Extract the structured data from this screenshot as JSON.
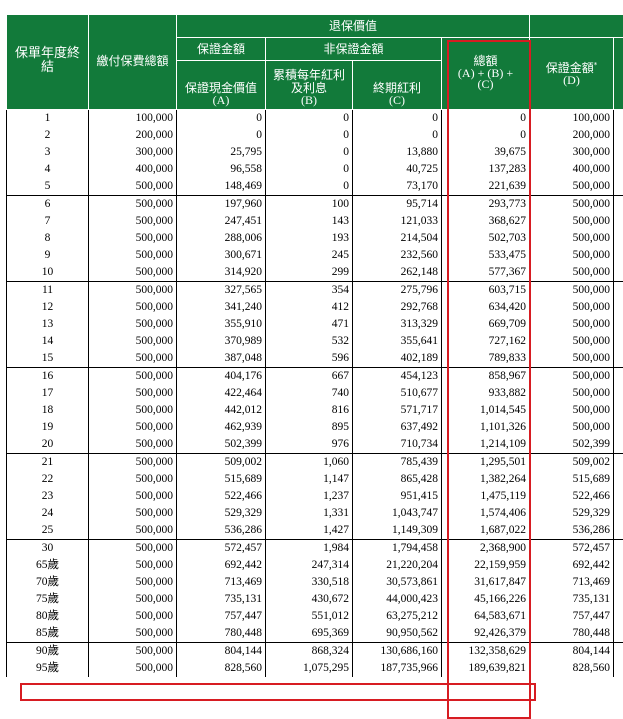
{
  "headers": {
    "policy_year": "保單年度終結",
    "premium_paid": "繳付保費總額",
    "retirement_value": "退保價值",
    "guaranteed_amount": "保證金額",
    "non_guaranteed_amount": "非保證金額",
    "guaranteed_cash_value": "保證現金價值",
    "guaranteed_cash_value_sub": "(A)",
    "accumulated_dividend": "累積每年紅利及利息",
    "accumulated_dividend_sub": "(B)",
    "terminal_bonus": "終期紅利",
    "terminal_bonus_sub": "(C)",
    "total": "總額",
    "total_formula": "(A) + (B) +",
    "total_sub": "(C)",
    "death_guaranteed": "保證金額",
    "death_guaranteed_mark": "*",
    "death_guaranteed_sub": "(D)"
  },
  "rows": [
    [
      "1",
      "100,000",
      "0",
      "0",
      "0",
      "0",
      "100,000"
    ],
    [
      "2",
      "200,000",
      "0",
      "0",
      "0",
      "0",
      "200,000"
    ],
    [
      "3",
      "300,000",
      "25,795",
      "0",
      "13,880",
      "39,675",
      "300,000"
    ],
    [
      "4",
      "400,000",
      "96,558",
      "0",
      "40,725",
      "137,283",
      "400,000"
    ],
    [
      "5",
      "500,000",
      "148,469",
      "0",
      "73,170",
      "221,639",
      "500,000"
    ],
    [
      "6",
      "500,000",
      "197,960",
      "100",
      "95,714",
      "293,773",
      "500,000"
    ],
    [
      "7",
      "500,000",
      "247,451",
      "143",
      "121,033",
      "368,627",
      "500,000"
    ],
    [
      "8",
      "500,000",
      "288,006",
      "193",
      "214,504",
      "502,703",
      "500,000"
    ],
    [
      "9",
      "500,000",
      "300,671",
      "245",
      "232,560",
      "533,475",
      "500,000"
    ],
    [
      "10",
      "500,000",
      "314,920",
      "299",
      "262,148",
      "577,367",
      "500,000"
    ],
    [
      "11",
      "500,000",
      "327,565",
      "354",
      "275,796",
      "603,715",
      "500,000"
    ],
    [
      "12",
      "500,000",
      "341,240",
      "412",
      "292,768",
      "634,420",
      "500,000"
    ],
    [
      "13",
      "500,000",
      "355,910",
      "471",
      "313,329",
      "669,709",
      "500,000"
    ],
    [
      "14",
      "500,000",
      "370,989",
      "532",
      "355,641",
      "727,162",
      "500,000"
    ],
    [
      "15",
      "500,000",
      "387,048",
      "596",
      "402,189",
      "789,833",
      "500,000"
    ],
    [
      "16",
      "500,000",
      "404,176",
      "667",
      "454,123",
      "858,967",
      "500,000"
    ],
    [
      "17",
      "500,000",
      "422,464",
      "740",
      "510,677",
      "933,882",
      "500,000"
    ],
    [
      "18",
      "500,000",
      "442,012",
      "816",
      "571,717",
      "1,014,545",
      "500,000"
    ],
    [
      "19",
      "500,000",
      "462,939",
      "895",
      "637,492",
      "1,101,326",
      "500,000"
    ],
    [
      "20",
      "500,000",
      "502,399",
      "976",
      "710,734",
      "1,214,109",
      "502,399"
    ],
    [
      "21",
      "500,000",
      "509,002",
      "1,060",
      "785,439",
      "1,295,501",
      "509,002"
    ],
    [
      "22",
      "500,000",
      "515,689",
      "1,147",
      "865,428",
      "1,382,264",
      "515,689"
    ],
    [
      "23",
      "500,000",
      "522,466",
      "1,237",
      "951,415",
      "1,475,119",
      "522,466"
    ],
    [
      "24",
      "500,000",
      "529,329",
      "1,331",
      "1,043,747",
      "1,574,406",
      "529,329"
    ],
    [
      "25",
      "500,000",
      "536,286",
      "1,427",
      "1,149,309",
      "1,687,022",
      "536,286"
    ],
    [
      "30",
      "500,000",
      "572,457",
      "1,984",
      "1,794,458",
      "2,368,900",
      "572,457"
    ],
    [
      "65歲",
      "500,000",
      "692,442",
      "247,314",
      "21,220,204",
      "22,159,959",
      "692,442"
    ],
    [
      "70歲",
      "500,000",
      "713,469",
      "330,518",
      "30,573,861",
      "31,617,847",
      "713,469"
    ],
    [
      "75歲",
      "500,000",
      "735,131",
      "430,672",
      "44,000,423",
      "45,166,226",
      "735,131"
    ],
    [
      "80歲",
      "500,000",
      "757,447",
      "551,012",
      "63,275,212",
      "64,583,671",
      "757,447"
    ],
    [
      "85歲",
      "500,000",
      "780,448",
      "695,369",
      "90,950,562",
      "92,426,379",
      "780,448"
    ],
    [
      "90歲",
      "500,000",
      "804,144",
      "868,324",
      "130,686,160",
      "132,358,629",
      "804,144"
    ],
    [
      "95歲",
      "500,000",
      "828,560",
      "1,075,295",
      "187,735,966",
      "189,639,821",
      "828,560"
    ]
  ],
  "group_end_rows": [
    4,
    9,
    14,
    19,
    24,
    30
  ],
  "highlight_row_index": 31,
  "highlight_color": "#d71c22",
  "header_color": "#127a3a"
}
